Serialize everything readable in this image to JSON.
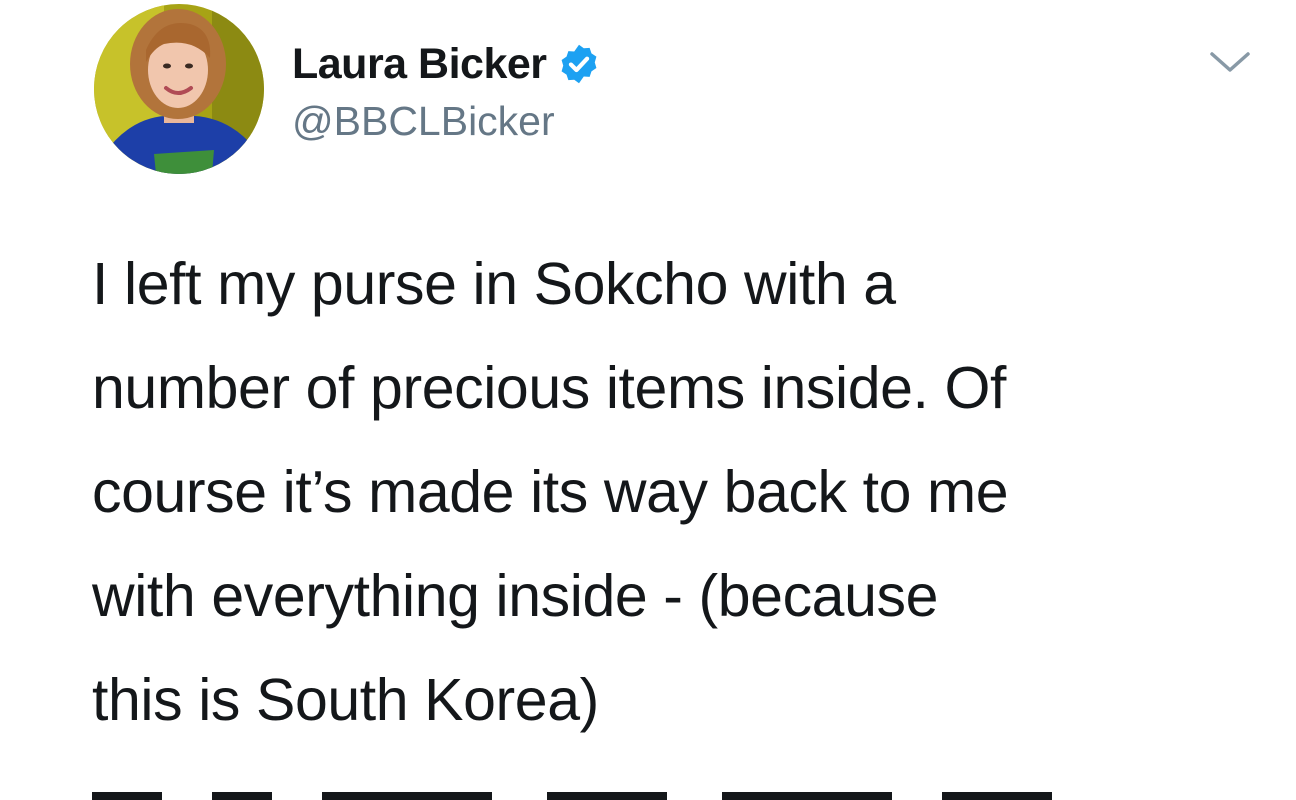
{
  "tweet": {
    "author": {
      "display_name": "Laura Bicker",
      "handle": "@BBCLBicker",
      "verified": true,
      "avatar_icon": "profile-photo",
      "verified_icon": "verified-badge-icon",
      "verified_color": "#1da1f2"
    },
    "menu_icon": "chevron-down-icon",
    "text": "I left my purse in Sokcho with a\nnumber of precious items inside. Of\ncourse it’s made its way back to me\nwith everything inside - (because\nthis is South Korea)"
  },
  "colors": {
    "text_primary": "#14171a",
    "text_secondary": "#657786",
    "chevron": "#8899a6"
  }
}
